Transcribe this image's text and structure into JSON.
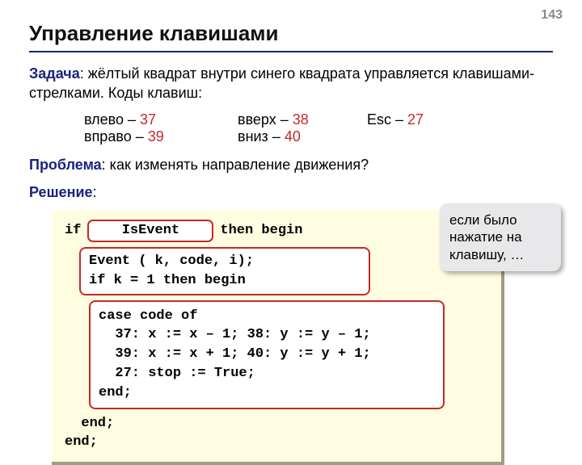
{
  "page_number": "143",
  "title": "Управление клавишами",
  "task_label": "Задача",
  "task_text": ": жёлтый квадрат внутри синего квадрата управляется клавишами-стрелками. Коды клавиш:",
  "keys": {
    "left_label": "влево – ",
    "left_code": "37",
    "up_label": "вверх – ",
    "up_code": "38",
    "esc_label": "Esc – ",
    "esc_code": "27",
    "right_label": "вправо – ",
    "right_code": "39",
    "down_label": "вниз – ",
    "down_code": "40"
  },
  "problem_label": "Проблема",
  "problem_text": ": как изменять направление движения?",
  "solution_label": "Решение",
  "solution_colon": ":",
  "code": {
    "if": "if",
    "isevent": "IsEvent",
    "then_begin": "then begin",
    "event_block": "Event ( k, code, i);\nif k = 1 then begin",
    "case_block": "case code of\n  37: x := x – 1; 38: y := y – 1;\n  39: x := x + 1; 40: y := y + 1;\n  27: stop := True;\nend;",
    "end1": "  end;",
    "end2": "end;"
  },
  "callout_text": "если было нажатие на клавишу, …"
}
